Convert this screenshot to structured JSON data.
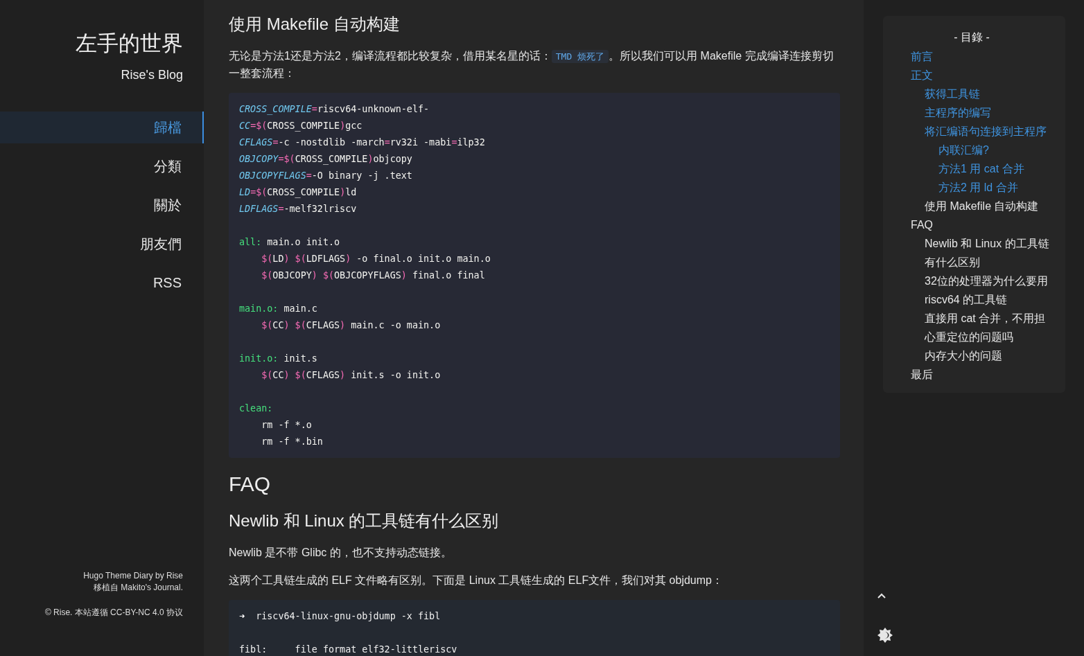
{
  "sidebar": {
    "title": "左手的世界",
    "subtitle": "Rise's Blog",
    "nav": [
      {
        "label": "歸檔",
        "selected": true
      },
      {
        "label": "分類",
        "selected": false
      },
      {
        "label": "關於",
        "selected": false
      },
      {
        "label": "朋友們",
        "selected": false
      },
      {
        "label": "RSS",
        "selected": false
      }
    ],
    "footer": {
      "credit": "Hugo Theme Diary by Rise",
      "port": "移植自 Makito's Journal.",
      "license": "© Rise. 本站遵循 CC-BY-NC 4.0 协议"
    }
  },
  "article": {
    "blocks": [
      {
        "kind": "h3",
        "text": "使用 Makefile 自动构建"
      },
      {
        "kind": "paragraph",
        "parts": [
          {
            "kind": "text",
            "text": "无论是方法1还是方法2，编译流程都比较复杂，借用某名星的话："
          },
          {
            "kind": "code",
            "text": "TMD 烦死了"
          },
          {
            "kind": "text",
            "text": "。所以我们可以用 Makefile 完成编译连接剪切一整套流程："
          }
        ]
      },
      {
        "kind": "code",
        "lines": [
          {
            "kind": "code",
            "indented": false,
            "tokens": [
              {
                "kind": "variable",
                "text": "CROSS_COMPILE"
              },
              {
                "kind": "operator",
                "text": "="
              },
              {
                "kind": "plain",
                "text": "riscv64-unknown-elf-"
              }
            ]
          },
          {
            "kind": "code",
            "indented": false,
            "tokens": [
              {
                "kind": "variable",
                "text": "CC"
              },
              {
                "kind": "operator",
                "text": "=$("
              },
              {
                "kind": "plain",
                "text": "CROSS_COMPILE"
              },
              {
                "kind": "operator",
                "text": ")"
              },
              {
                "kind": "plain",
                "text": "gcc"
              }
            ]
          },
          {
            "kind": "code",
            "indented": false,
            "tokens": [
              {
                "kind": "variable",
                "text": "CFLAGS"
              },
              {
                "kind": "operator",
                "text": "="
              },
              {
                "kind": "plain",
                "text": "-c -nostdlib -march"
              },
              {
                "kind": "operator",
                "text": "="
              },
              {
                "kind": "plain",
                "text": "rv32i -mabi"
              },
              {
                "kind": "operator",
                "text": "="
              },
              {
                "kind": "plain",
                "text": "ilp32"
              }
            ]
          },
          {
            "kind": "code",
            "indented": false,
            "tokens": [
              {
                "kind": "variable",
                "text": "OBJCOPY"
              },
              {
                "kind": "operator",
                "text": "=$("
              },
              {
                "kind": "plain",
                "text": "CROSS_COMPILE"
              },
              {
                "kind": "operator",
                "text": ")"
              },
              {
                "kind": "plain",
                "text": "objcopy"
              }
            ]
          },
          {
            "kind": "code",
            "indented": false,
            "tokens": [
              {
                "kind": "variable",
                "text": "OBJCOPYFLAGS"
              },
              {
                "kind": "operator",
                "text": "="
              },
              {
                "kind": "plain",
                "text": "-O binary -j .text"
              }
            ]
          },
          {
            "kind": "code",
            "indented": false,
            "tokens": [
              {
                "kind": "variable",
                "text": "LD"
              },
              {
                "kind": "operator",
                "text": "=$("
              },
              {
                "kind": "plain",
                "text": "CROSS_COMPILE"
              },
              {
                "kind": "operator",
                "text": ")"
              },
              {
                "kind": "plain",
                "text": "ld"
              }
            ]
          },
          {
            "kind": "code",
            "indented": false,
            "tokens": [
              {
                "kind": "variable",
                "text": "LDFLAGS"
              },
              {
                "kind": "operator",
                "text": "="
              },
              {
                "kind": "plain",
                "text": "-melf32lriscv"
              }
            ]
          },
          {
            "kind": "blank"
          },
          {
            "kind": "code",
            "indented": false,
            "tokens": [
              {
                "kind": "target",
                "text": "all:"
              },
              {
                "kind": "plain",
                "text": " main.o init.o"
              }
            ]
          },
          {
            "kind": "code",
            "indented": true,
            "tokens": [
              {
                "kind": "operator",
                "text": "$("
              },
              {
                "kind": "plain",
                "text": "LD"
              },
              {
                "kind": "operator",
                "text": ")"
              },
              {
                "kind": "operator",
                "text": " $("
              },
              {
                "kind": "plain",
                "text": "LDFLAGS"
              },
              {
                "kind": "operator",
                "text": ")"
              },
              {
                "kind": "plain",
                "text": " -o final.o init.o main.o"
              }
            ]
          },
          {
            "kind": "code",
            "indented": true,
            "tokens": [
              {
                "kind": "operator",
                "text": "$("
              },
              {
                "kind": "plain",
                "text": "OBJCOPY"
              },
              {
                "kind": "operator",
                "text": ")"
              },
              {
                "kind": "operator",
                "text": " $("
              },
              {
                "kind": "plain",
                "text": "OBJCOPYFLAGS"
              },
              {
                "kind": "operator",
                "text": ")"
              },
              {
                "kind": "plain",
                "text": " final.o final"
              }
            ]
          },
          {
            "kind": "blank"
          },
          {
            "kind": "code",
            "indented": false,
            "tokens": [
              {
                "kind": "target",
                "text": "main.o:"
              },
              {
                "kind": "plain",
                "text": " main.c"
              }
            ]
          },
          {
            "kind": "code",
            "indented": true,
            "tokens": [
              {
                "kind": "operator",
                "text": "$("
              },
              {
                "kind": "plain",
                "text": "CC"
              },
              {
                "kind": "operator",
                "text": ")"
              },
              {
                "kind": "operator",
                "text": " $("
              },
              {
                "kind": "plain",
                "text": "CFLAGS"
              },
              {
                "kind": "operator",
                "text": ")"
              },
              {
                "kind": "plain",
                "text": " main.c -o main.o"
              }
            ]
          },
          {
            "kind": "blank"
          },
          {
            "kind": "code",
            "indented": false,
            "tokens": [
              {
                "kind": "target",
                "text": "init.o:"
              },
              {
                "kind": "plain",
                "text": " init.s"
              }
            ]
          },
          {
            "kind": "code",
            "indented": true,
            "tokens": [
              {
                "kind": "operator",
                "text": "$("
              },
              {
                "kind": "plain",
                "text": "CC"
              },
              {
                "kind": "operator",
                "text": ")"
              },
              {
                "kind": "operator",
                "text": " $("
              },
              {
                "kind": "plain",
                "text": "CFLAGS"
              },
              {
                "kind": "operator",
                "text": ")"
              },
              {
                "kind": "plain",
                "text": " init.s -o init.o"
              }
            ]
          },
          {
            "kind": "blank"
          },
          {
            "kind": "code",
            "indented": false,
            "tokens": [
              {
                "kind": "target",
                "text": "clean:"
              }
            ]
          },
          {
            "kind": "code",
            "indented": true,
            "tokens": [
              {
                "kind": "plain",
                "text": "rm -f *.o"
              }
            ]
          },
          {
            "kind": "code",
            "indented": true,
            "tokens": [
              {
                "kind": "plain",
                "text": "rm -f *.bin"
              }
            ]
          }
        ]
      },
      {
        "kind": "h2",
        "text": "FAQ"
      },
      {
        "kind": "h3",
        "text": "Newlib 和 Linux 的工具链有什么区别"
      },
      {
        "kind": "paragraph",
        "parts": [
          {
            "kind": "text",
            "text": "Newlib 是不带 Glibc 的，也不支持动态链接。"
          }
        ]
      },
      {
        "kind": "paragraph",
        "parts": [
          {
            "kind": "text",
            "text": "这两个工具链生成的 ELF 文件略有区别。下面是 Linux 工具链生成的 ELF文件，我们对其 objdump："
          }
        ]
      },
      {
        "kind": "terminal",
        "lines": [
          {
            "kind": "code",
            "indented": false,
            "tokens": [
              {
                "kind": "prompt",
                "text": "➜"
              },
              {
                "kind": "plain",
                "text": "  riscv64-linux-gnu-objdump -x fibl"
              }
            ]
          },
          {
            "kind": "blank"
          },
          {
            "kind": "code",
            "indented": false,
            "tokens": [
              {
                "kind": "plain",
                "text": "fibl:     file format elf32-littleriscv"
              }
            ]
          }
        ]
      }
    ]
  },
  "toc": {
    "title": "- 目錄 -",
    "items": [
      {
        "text": "前言",
        "read": true
      },
      {
        "text": "正文",
        "read": true,
        "children": [
          {
            "text": "获得工具链",
            "read": true
          },
          {
            "text": "主程序的编写",
            "read": true
          },
          {
            "text": "将汇编语句连接到主程序",
            "read": true,
            "children": [
              {
                "text": "内联汇编?",
                "read": true
              },
              {
                "text": "方法1 用 cat 合并",
                "read": true
              },
              {
                "text": "方法2 用 ld 合并",
                "read": true
              }
            ]
          },
          {
            "text": "使用 Makefile 自动构建",
            "read": false
          }
        ]
      },
      {
        "text": "FAQ",
        "read": false,
        "children": [
          {
            "text": "Newlib 和 Linux 的工具链有什么区别",
            "read": false
          },
          {
            "text": "32位的处理器为什么要用 riscv64 的工具链",
            "read": false
          },
          {
            "text": "直接用 cat 合并，不用担心重定位的问题吗",
            "read": false
          },
          {
            "text": "内存大小的问题",
            "read": false
          }
        ]
      },
      {
        "text": "最后",
        "read": false
      }
    ]
  }
}
